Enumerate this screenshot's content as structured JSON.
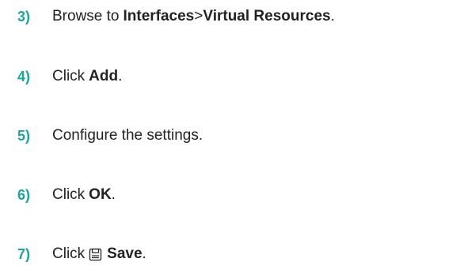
{
  "steps": [
    {
      "number": "3)",
      "prefix": "Browse to ",
      "bold1": "Interfaces",
      "separator": " > ",
      "bold2": "Virtual Resources",
      "suffix": "."
    },
    {
      "number": "4)",
      "prefix": "Click ",
      "bold": "Add",
      "suffix": "."
    },
    {
      "number": "5)",
      "text": "Configure the settings."
    },
    {
      "number": "6)",
      "prefix": "Click ",
      "bold": "OK",
      "suffix": "."
    },
    {
      "number": "7)",
      "prefix": "Click ",
      "icon": "save-icon",
      "bold": "Save",
      "suffix": "."
    }
  ],
  "colors": {
    "step_number": "#22a39a",
    "text": "#222222"
  }
}
